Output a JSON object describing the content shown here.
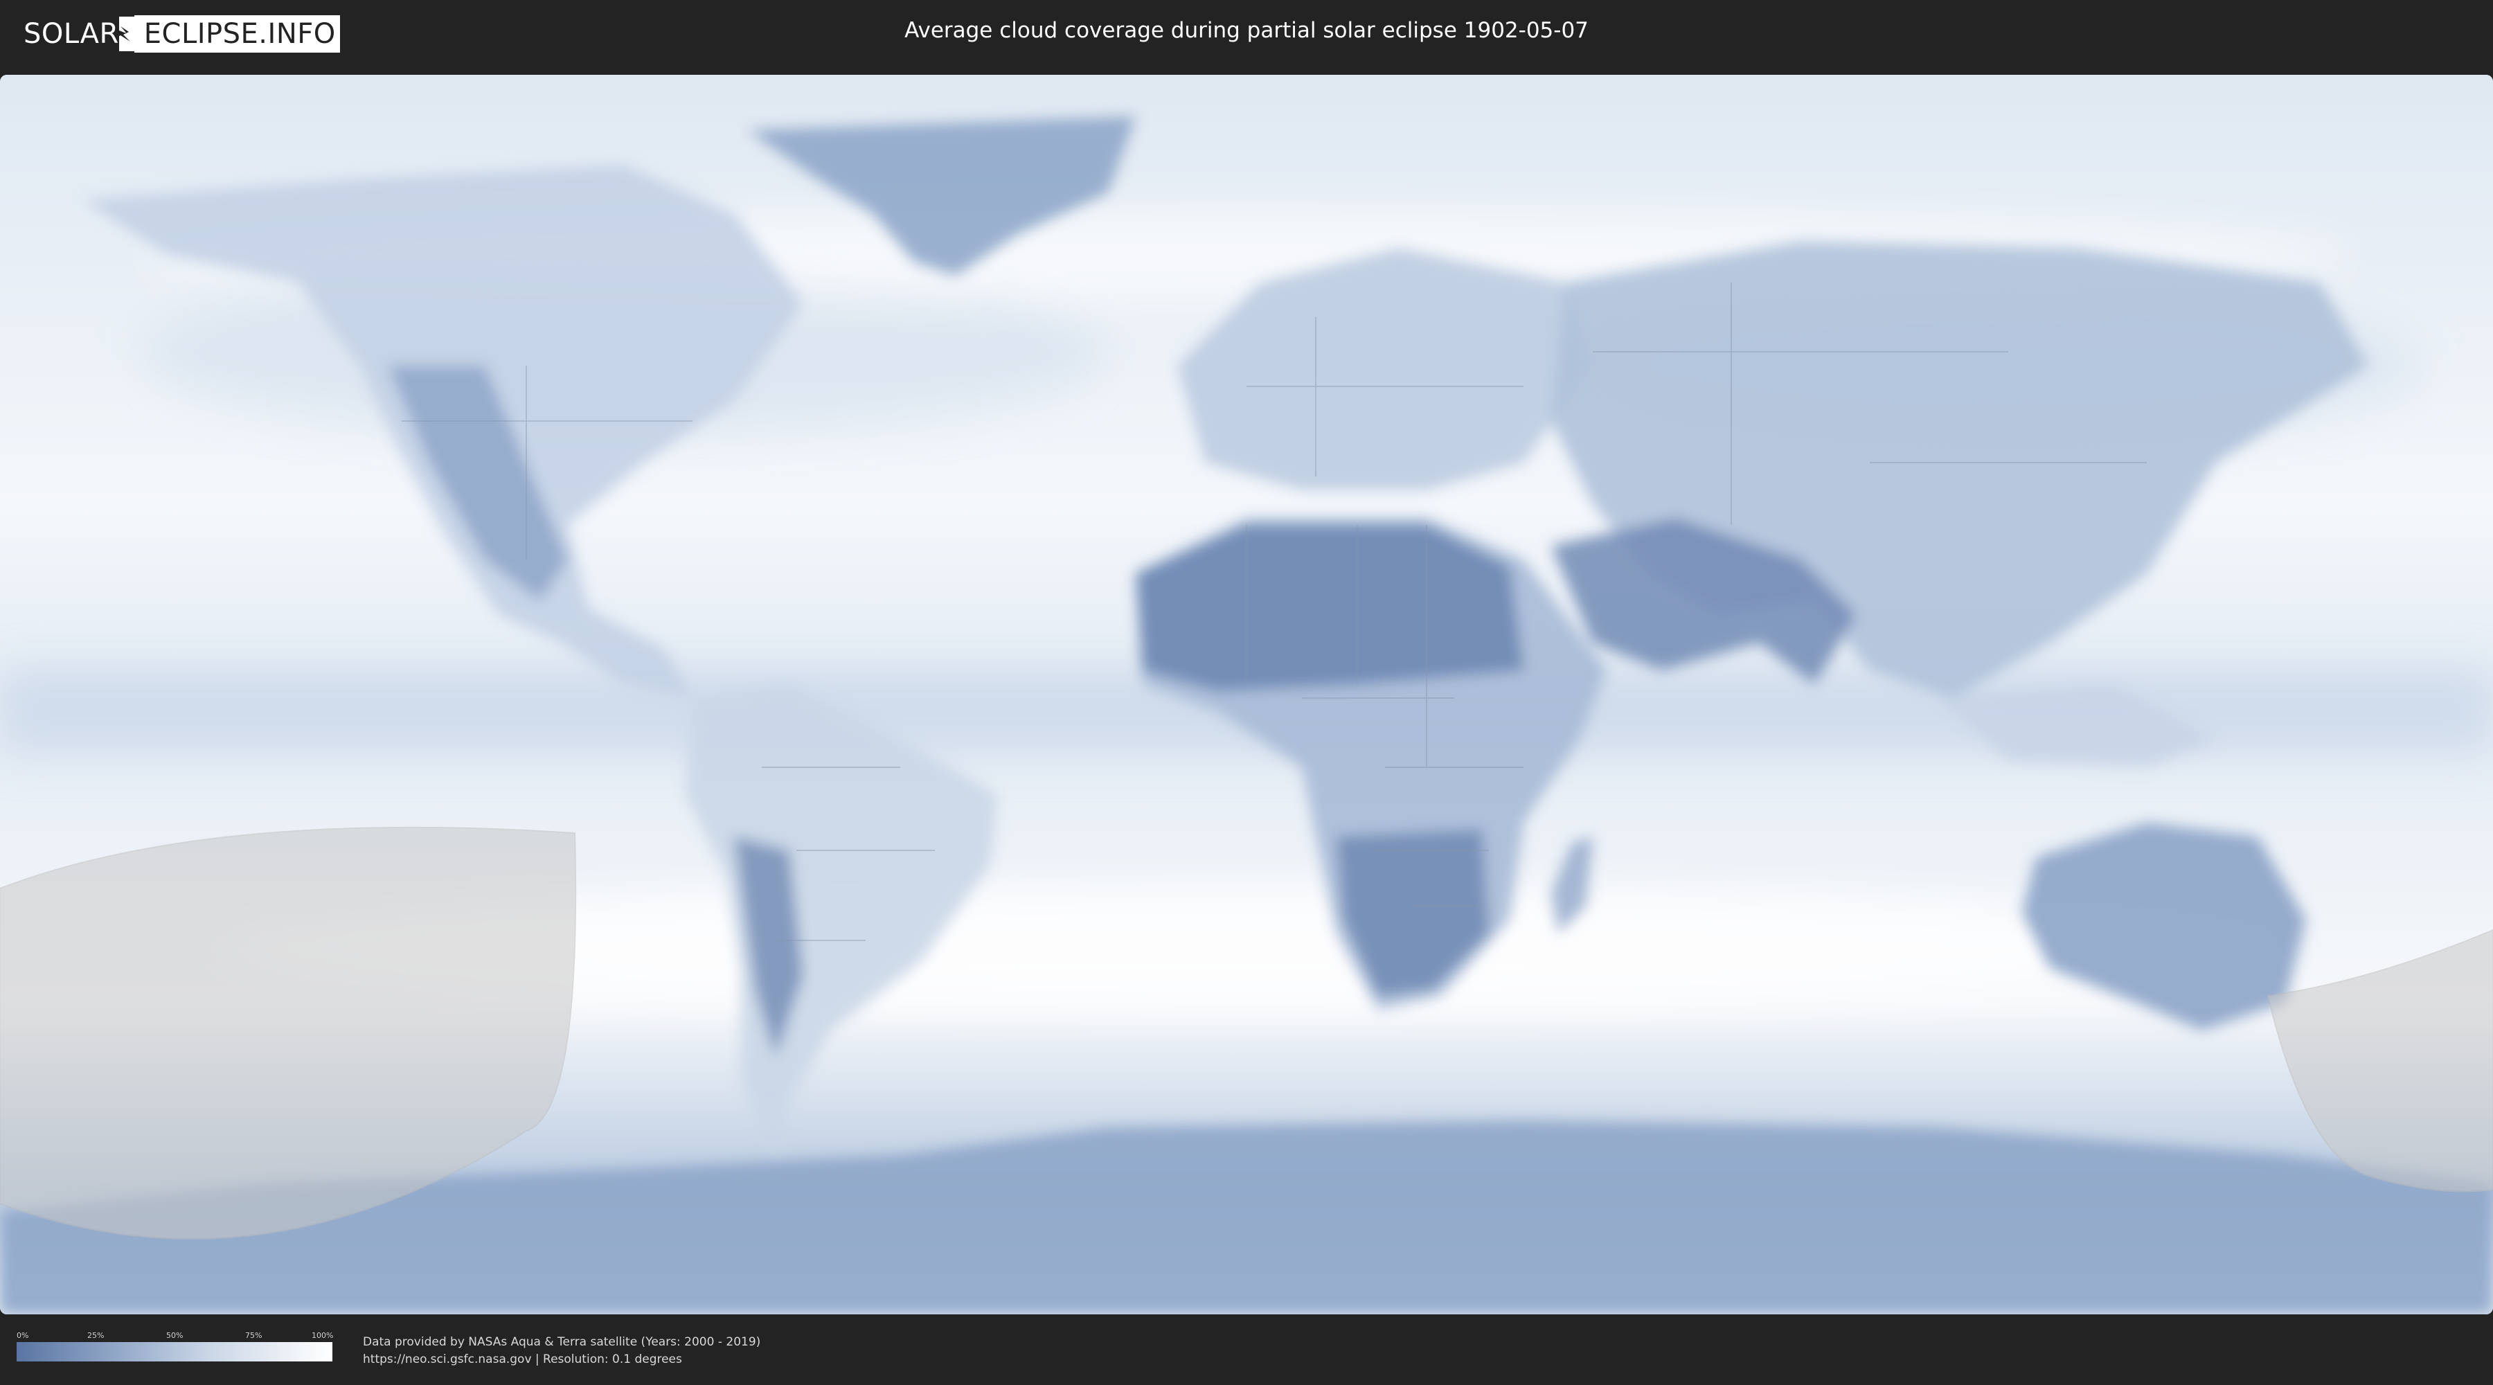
{
  "header": {
    "logo_left": "SOLAR",
    "logo_right": "ECLIPSE.INFO",
    "title": "Average cloud coverage during partial solar eclipse 1902-05-07"
  },
  "legend": {
    "ticks": [
      "0%",
      "25%",
      "50%",
      "75%",
      "100%"
    ],
    "gradient_colors": [
      "#5a75a3",
      "#ffffff"
    ]
  },
  "credits": {
    "line1": "Data provided by NASAs Aqua & Terra satellite (Years: 2000 - 2019)",
    "line2": "https://neo.sci.gsfc.nasa.gov | Resolution: 0.1 degrees"
  },
  "colors": {
    "background": "#232323",
    "cloud_high": "#ffffff",
    "cloud_low": "#5a75a3",
    "eclipse_overlay": "#c8c8c8"
  }
}
